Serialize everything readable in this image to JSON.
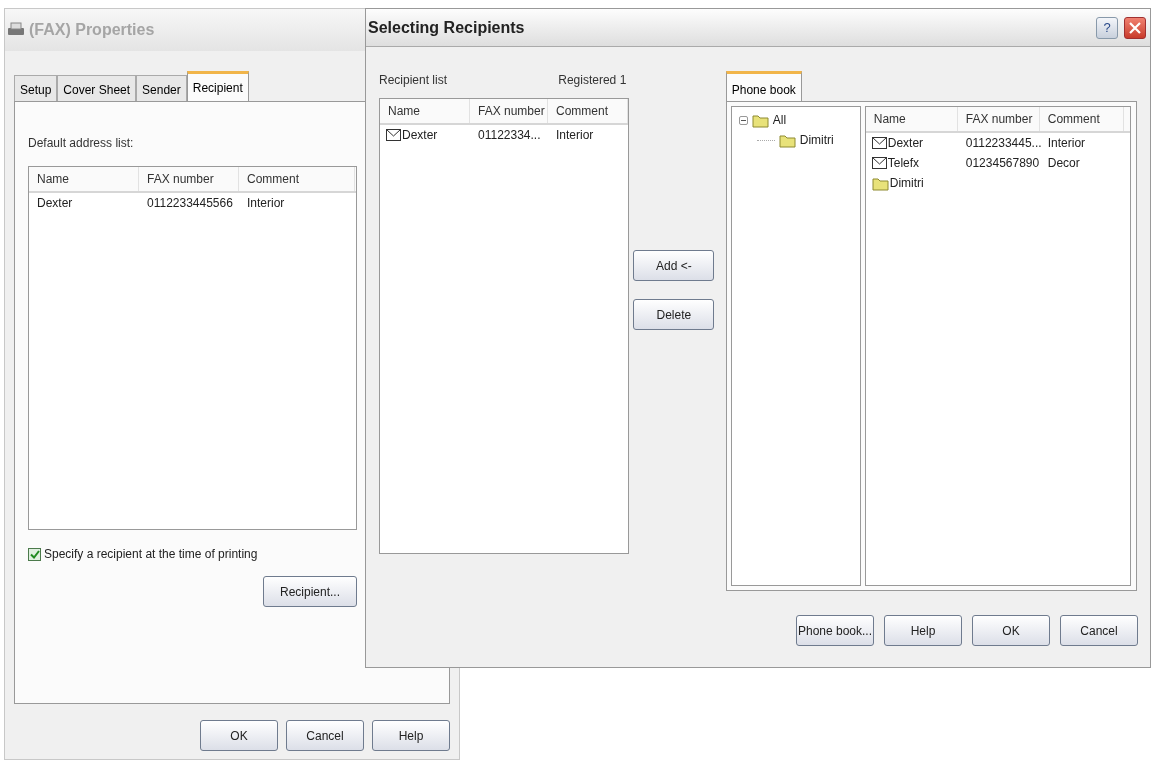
{
  "properties_window": {
    "title": "(FAX) Properties",
    "active": false,
    "tabs": [
      {
        "label": "Setup",
        "selected": false
      },
      {
        "label": "Cover Sheet",
        "selected": false
      },
      {
        "label": "Sender",
        "selected": false
      },
      {
        "label": "Recipient",
        "selected": true
      }
    ],
    "address_list_label": "Default address list:",
    "columns": [
      "Name",
      "FAX number",
      "Comment"
    ],
    "rows": [
      {
        "name": "Dexter",
        "fax": "0112233445566",
        "comment": "Interior"
      }
    ],
    "specify_checkbox": {
      "label": "Specify a recipient at the time of printing",
      "checked": true
    },
    "recipient_button": "Recipient...",
    "buttons": [
      "OK",
      "Cancel",
      "Help"
    ]
  },
  "selecting_window": {
    "title": "Selecting Recipients",
    "active": true,
    "help_button": "?",
    "recipient_list": {
      "label": "Recipient list",
      "count": "Registered 1",
      "columns": [
        "Name",
        "FAX number",
        "Comment"
      ],
      "rows": [
        {
          "kind": "contact",
          "name": "Dexter",
          "fax": "01122334...",
          "comment": "Interior"
        }
      ]
    },
    "actions": [
      "Add <-",
      "Delete"
    ],
    "phone_book": {
      "tab": {
        "label": "Phone book",
        "selected": true
      },
      "tree": [
        {
          "label": "All",
          "expanded": true,
          "children": [
            {
              "label": "Dimitri"
            }
          ]
        }
      ],
      "columns": [
        "Name",
        "FAX number",
        "Comment"
      ],
      "rows": [
        {
          "kind": "contact",
          "name": "Dexter",
          "fax": "0112233445...",
          "comment": "Interior"
        },
        {
          "kind": "contact",
          "name": "Telefx",
          "fax": "01234567890",
          "comment": "Decor"
        },
        {
          "kind": "folder",
          "name": "Dimitri"
        }
      ]
    },
    "buttons": [
      "Phone book...",
      "Help",
      "OK",
      "Cancel"
    ]
  }
}
